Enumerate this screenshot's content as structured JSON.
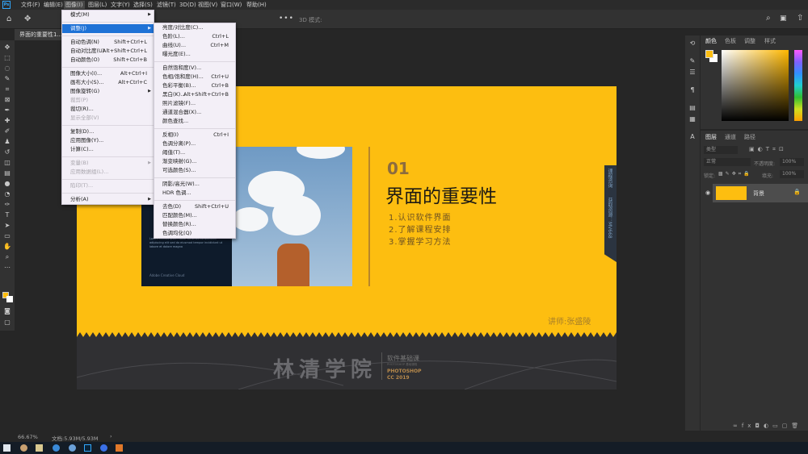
{
  "app": {
    "logo": "Ps",
    "menubar": [
      "文件(F)",
      "编辑(E)",
      "图像(I)",
      "图层(L)",
      "文字(Y)",
      "选择(S)",
      "滤镜(T)",
      "3D(D)",
      "视图(V)",
      "窗口(W)",
      "帮助(H)"
    ],
    "active_menu": "图像(I)"
  },
  "options": {
    "mode3d": "3D 模式:"
  },
  "document": {
    "tab": "界面的重要性1..."
  },
  "image_menu": [
    [
      {
        "label": "模式(M)",
        "arrow": true
      }
    ],
    [
      {
        "label": "调整(J)",
        "arrow": true,
        "highlight": true
      }
    ],
    [
      {
        "label": "自动色调(N)",
        "shortcut": "Shift+Ctrl+L"
      },
      {
        "label": "自动对比度(U)",
        "shortcut": "Alt+Shift+Ctrl+L"
      },
      {
        "label": "自动颜色(O)",
        "shortcut": "Shift+Ctrl+B"
      }
    ],
    [
      {
        "label": "图像大小(I)...",
        "shortcut": "Alt+Ctrl+I"
      },
      {
        "label": "画布大小(S)...",
        "shortcut": "Alt+Ctrl+C"
      },
      {
        "label": "图像旋转(G)",
        "arrow": true
      },
      {
        "label": "裁剪(P)",
        "disabled": true
      },
      {
        "label": "裁切(R)..."
      },
      {
        "label": "显示全部(V)",
        "disabled": true
      }
    ],
    [
      {
        "label": "复制(D)..."
      },
      {
        "label": "应用图像(Y)..."
      },
      {
        "label": "计算(C)..."
      }
    ],
    [
      {
        "label": "变量(B)",
        "arrow": true,
        "disabled": true
      },
      {
        "label": "应用数据组(L)...",
        "disabled": true
      }
    ],
    [
      {
        "label": "陷印(T)...",
        "disabled": true
      }
    ],
    [
      {
        "label": "分析(A)",
        "arrow": true
      }
    ]
  ],
  "adjust_menu": [
    [
      {
        "label": "亮度/对比度(C)..."
      },
      {
        "label": "色阶(L)...",
        "shortcut": "Ctrl+L"
      },
      {
        "label": "曲线(U)...",
        "shortcut": "Ctrl+M"
      },
      {
        "label": "曝光度(E)..."
      }
    ],
    [
      {
        "label": "自然饱和度(V)..."
      },
      {
        "label": "色相/饱和度(H)...",
        "shortcut": "Ctrl+U"
      },
      {
        "label": "色彩平衡(B)...",
        "shortcut": "Ctrl+B"
      },
      {
        "label": "黑白(K)...",
        "shortcut": "Alt+Shift+Ctrl+B"
      },
      {
        "label": "照片滤镜(F)..."
      },
      {
        "label": "通道混合器(X)..."
      },
      {
        "label": "颜色查找..."
      }
    ],
    [
      {
        "label": "反相(I)",
        "shortcut": "Ctrl+I"
      },
      {
        "label": "色调分离(P)..."
      },
      {
        "label": "阈值(T)..."
      },
      {
        "label": "渐变映射(G)..."
      },
      {
        "label": "可选颜色(S)..."
      }
    ],
    [
      {
        "label": "阴影/高光(W)..."
      },
      {
        "label": "HDR 色调..."
      }
    ],
    [
      {
        "label": "去色(D)",
        "shortcut": "Shift+Ctrl+U"
      },
      {
        "label": "匹配颜色(M)..."
      },
      {
        "label": "替换颜色(R)..."
      },
      {
        "label": "色调均化(Q)"
      }
    ]
  ],
  "slide": {
    "number": "01",
    "title": "界面的重要性",
    "items": [
      "1.认识软件界面",
      "2.了解课程安排",
      "3.掌握学习方法"
    ],
    "ribbon": [
      "课程咨询",
      "获取资源：MV668"
    ],
    "teacher": "讲师:张盛陵",
    "logo": "林清学院",
    "sub1": "软件基础课",
    "sub2": "PHOTOSHOP 基础课程",
    "sub3": "PHOTOSHOP",
    "sub4": "CC 2019",
    "brand": "Adobe Creative Cloud",
    "bg": "#fdbe10"
  },
  "color_panel": {
    "tabs": [
      "颜色",
      "色板",
      "调整",
      "样式"
    ],
    "fg": "#fdbe10"
  },
  "layers_panel": {
    "tabs": [
      "图层",
      "通道",
      "路径"
    ],
    "filter": "类型",
    "blend": "正常",
    "opacity_label": "不透明度:",
    "opacity": "100%",
    "lock_label": "锁定:",
    "fill_label": "填充:",
    "fill": "100%",
    "layer_name": "背景"
  },
  "status": {
    "zoom": "66.67%",
    "doc": "文档:5.93M/5.93M"
  }
}
